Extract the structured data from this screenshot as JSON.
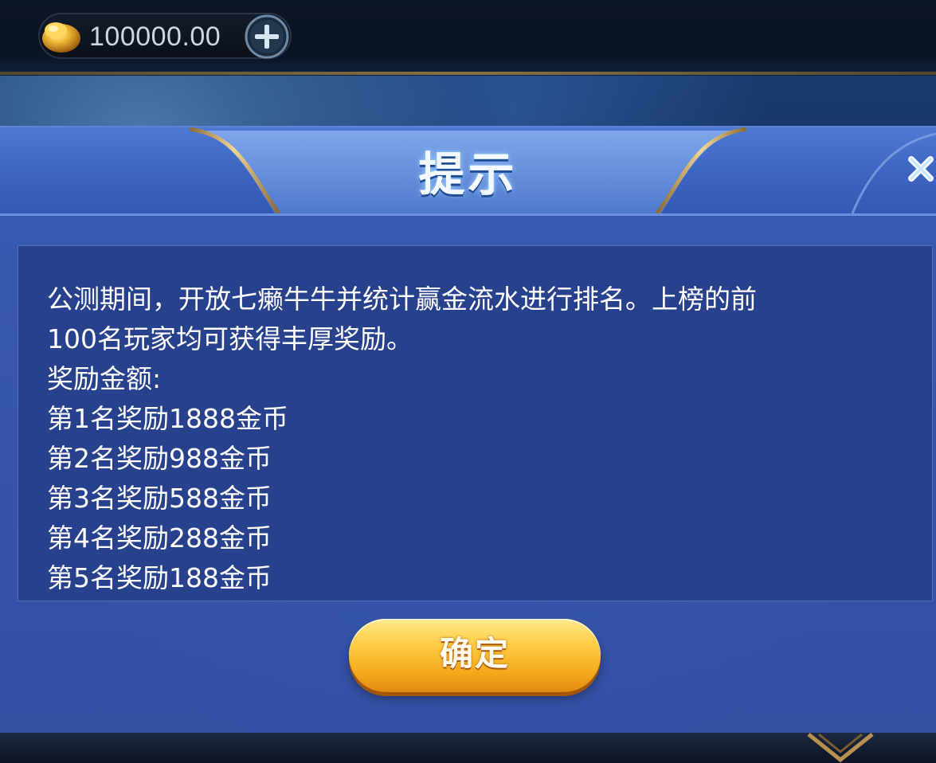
{
  "topbar": {
    "balance": "100000.00",
    "coin_icon": "gold-ingot-icon",
    "add_icon": "plus-icon"
  },
  "dialog": {
    "title": "提示",
    "close_icon": "close-icon",
    "content_lines": [
      "公测期间，开放七癞牛牛并统计赢金流水进行排名。上榜的前",
      "100名玩家均可获得丰厚奖励。",
      "奖励金额:",
      "第1名奖励1888金币",
      "第2名奖励988金币",
      "第3名奖励588金币",
      "第4名奖励288金币",
      "第5名奖励188金币"
    ],
    "confirm_label": "确定"
  },
  "colors": {
    "dialog_bg": "#3a5bb2",
    "content_bg": "#27418d",
    "button_gold": "#ffcc45",
    "title_glow": "#9fd0ff"
  }
}
